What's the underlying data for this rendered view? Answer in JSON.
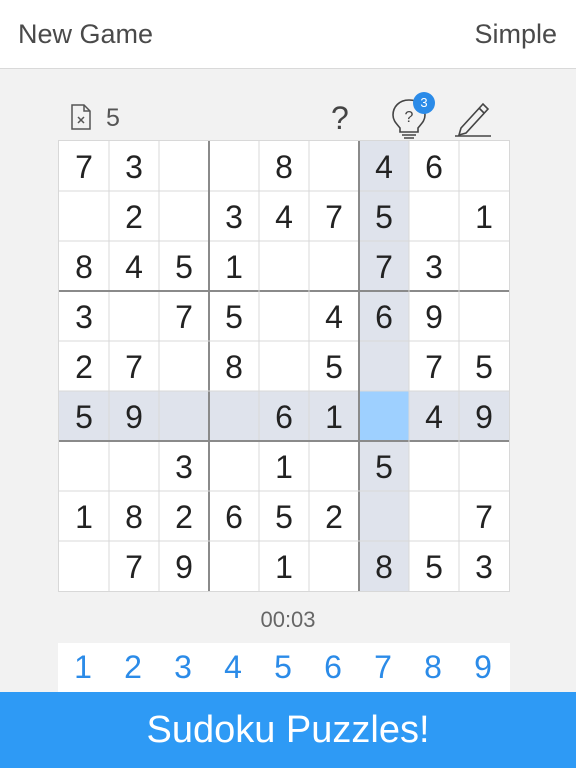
{
  "header": {
    "new_game_label": "New Game",
    "difficulty_label": "Simple"
  },
  "toolbar": {
    "mistakes_icon": "file-x-icon",
    "mistakes": "5",
    "help_label": "?",
    "hint_icon": "lightbulb-question-icon",
    "hint_count": "3",
    "pencil_icon": "pencil-icon"
  },
  "board": {
    "selected": {
      "row": 5,
      "col": 6
    },
    "rows": [
      [
        "7",
        "3",
        "",
        "",
        "8",
        "",
        "4",
        "6",
        ""
      ],
      [
        "",
        "2",
        "",
        "3",
        "4",
        "7",
        "5",
        "",
        "1"
      ],
      [
        "8",
        "4",
        "5",
        "1",
        "",
        "",
        "7",
        "3",
        ""
      ],
      [
        "3",
        "",
        "7",
        "5",
        "",
        "4",
        "6",
        "9",
        ""
      ],
      [
        "2",
        "7",
        "",
        "8",
        "",
        "5",
        "",
        "7",
        "5"
      ],
      [
        "5",
        "9",
        "",
        "",
        "6",
        "1",
        "",
        "4",
        "9"
      ],
      [
        "",
        "",
        "3",
        "",
        "1",
        "",
        "5",
        "",
        ""
      ],
      [
        "1",
        "8",
        "2",
        "6",
        "5",
        "2",
        "",
        "",
        "7"
      ],
      [
        "",
        "7",
        "9",
        "",
        "1",
        "",
        "8",
        "5",
        "3"
      ]
    ]
  },
  "timer": "00:03",
  "numpad": [
    "1",
    "2",
    "3",
    "4",
    "5",
    "6",
    "7",
    "8",
    "9"
  ],
  "banner": "Sudoku Puzzles!",
  "colors": {
    "accent": "#2b8be8",
    "banner": "#2e9af5",
    "highlight": "#dfe3ec",
    "selected": "#9ed0ff"
  }
}
